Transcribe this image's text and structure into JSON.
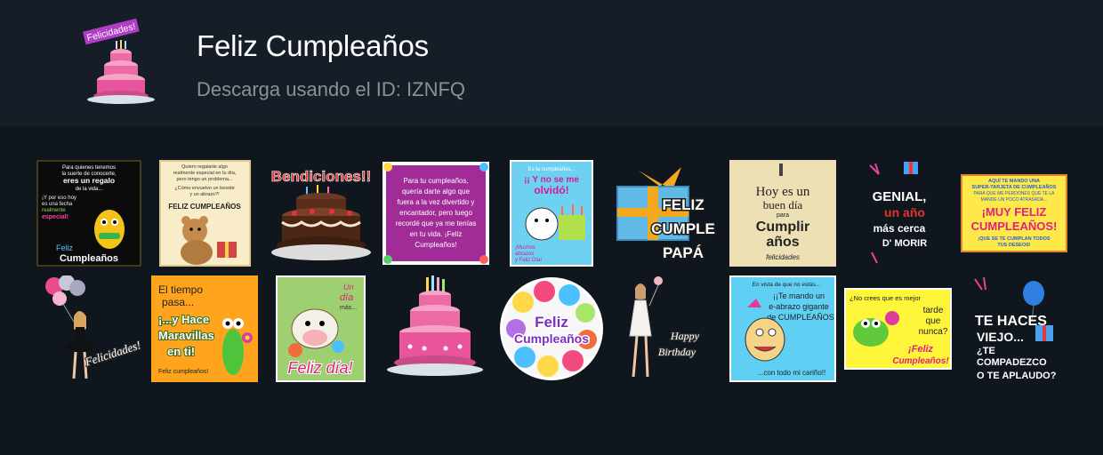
{
  "pack": {
    "title": "Feliz Cumpleaños",
    "subtitle": "Descarga usando el ID: IZNFQ",
    "icon_label": "Felicidades!"
  },
  "colors": {
    "header_bg": "#151e26",
    "page_bg": "#0f161d",
    "title": "#ffffff",
    "subtitle": "#8a9097"
  },
  "stickers": [
    {
      "kind": "card-dark-giraffe",
      "lines": [
        "Para quienes tenemos",
        "la suerte de conocerte,",
        "eres un regalo",
        "de la vida...",
        "¡Y por eso hoy",
        "es una fecha",
        "realmente",
        "especial!",
        "Feliz",
        "Cumpleaños"
      ]
    },
    {
      "kind": "card-teddy",
      "lines": [
        "Quiero regalarte algo",
        "realmente especial en tu día,",
        "pero tengo un problema...",
        "¿Cómo envuelvo un besote",
        "y un abrazo?!",
        "FELIZ CUMPLEAÑOS"
      ]
    },
    {
      "kind": "cake-bendiciones",
      "lines": [
        "Bendiciones!!"
      ]
    },
    {
      "kind": "card-frame",
      "lines": [
        "Para tu cumpleaños,",
        "quería darte algo que",
        "fuera a la vez divertido y",
        "encantador, pero luego",
        "recordé que ya me tenías",
        "en tu vida. ¡Feliz",
        "Cumpleaños!"
      ]
    },
    {
      "kind": "card-bear-forgot",
      "lines": [
        "Es tu cumpleaños...",
        "¡¡ Y no se me",
        "olvidó!",
        "¡Muchos",
        "abrazos",
        "y Feliz Día!"
      ]
    },
    {
      "kind": "gift-papa",
      "lines": [
        "FELIZ",
        "CUMPLE",
        "PAPÁ"
      ]
    },
    {
      "kind": "card-buen-dia",
      "lines": [
        "Hoy es un",
        "buen día",
        "para",
        "Cumplir",
        "años",
        "felicidades"
      ]
    },
    {
      "kind": "text-genial",
      "lines": [
        "GENIAL,",
        "un año",
        "más cerca",
        "D' MORIR"
      ]
    },
    {
      "kind": "card-super-tarjeta",
      "lines": [
        "AQUÍ TE MANDO UNA",
        "SUPER-TARJETA DE CUMPLEAÑOS",
        "PARA QUE ME PERDONES QUE TE LA",
        "MANDE UN POCO ATRASADA...",
        "¡MUY FELIZ",
        "CUMPLEAÑOS!",
        "¡QUE SE TE CUMPLAN TODOS",
        "TUS DESEOS!"
      ]
    },
    {
      "kind": "girl-balloons",
      "lines": [
        "Felicidades!"
      ]
    },
    {
      "kind": "card-frog-flower",
      "lines": [
        "El tiempo",
        "pasa...",
        "¡...y Hace",
        "Maravillas",
        "en ti!",
        "Feliz cumpleaños!"
      ]
    },
    {
      "kind": "card-cow",
      "lines": [
        "Un",
        "día",
        "más...",
        "Feliz día!"
      ]
    },
    {
      "kind": "cake-pink",
      "lines": []
    },
    {
      "kind": "balloon-feliz",
      "lines": [
        "Feliz",
        "Cumpleaños"
      ]
    },
    {
      "kind": "girl-happy-birthday",
      "lines": [
        "Happy",
        "Birthday"
      ]
    },
    {
      "kind": "card-abrazo",
      "lines": [
        "En vista de que no estás...",
        "¡¡Te mando un",
        "e-abrazo gigante",
        "de CUMPLEAÑOS",
        "...con todo mi cariño!!"
      ]
    },
    {
      "kind": "card-tarde",
      "lines": [
        "¿No crees que es mejor",
        "tarde",
        "que",
        "nunca?",
        "¡Feliz",
        "Cumpleaños!"
      ]
    },
    {
      "kind": "text-viejo",
      "lines": [
        "TE HACES",
        "VIEJO...",
        "¿TE",
        "COMPADEZCO",
        "O TE APLAUDO?"
      ]
    }
  ]
}
